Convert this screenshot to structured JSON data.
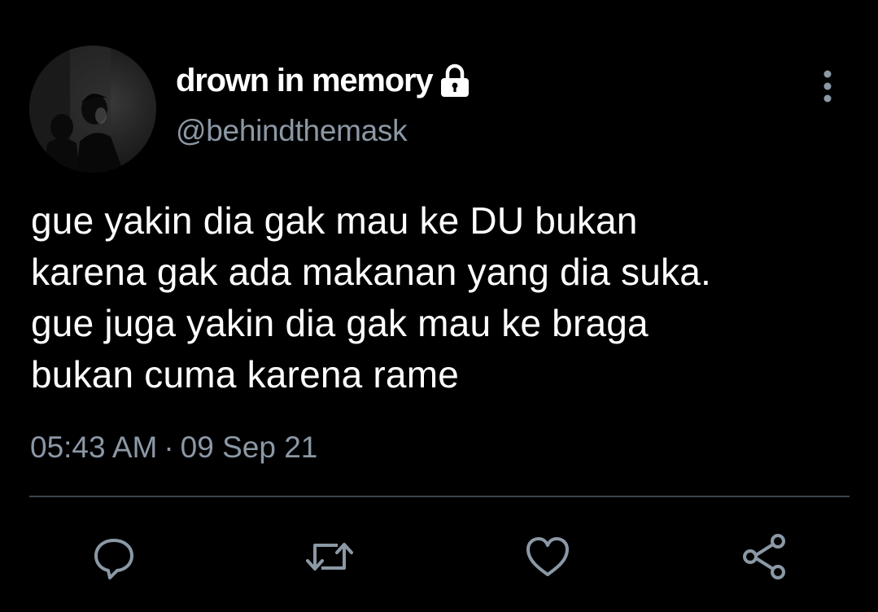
{
  "tweet": {
    "display_name": "drown in memory",
    "handle": "@behindthemask",
    "text": "gue yakin dia gak mau ke DU bukan\nkarena gak ada makanan yang dia suka.\ngue juga yakin dia gak mau ke braga\nbukan cuma karena rame",
    "time": "05:43 AM",
    "separator": "·",
    "date": "09 Sep 21"
  },
  "icons": {
    "lock": "lock-icon",
    "more": "more-vertical-icon",
    "reply": "reply-icon",
    "retweet": "retweet-icon",
    "like": "heart-icon",
    "share": "share-icon"
  },
  "colors": {
    "background": "#000000",
    "text": "#ffffff",
    "secondary_text": "#8b98a5",
    "divider": "#38444d"
  }
}
